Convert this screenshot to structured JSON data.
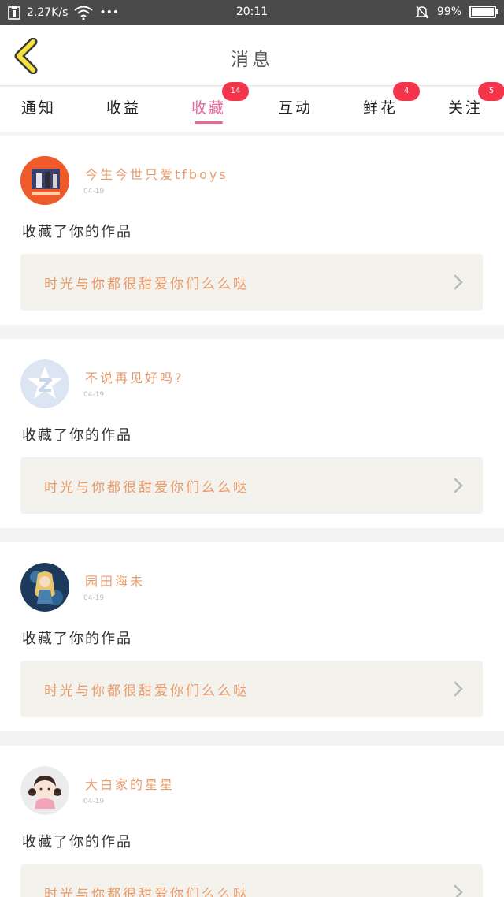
{
  "status_bar": {
    "speed": "2.27K/s",
    "dots": "•••",
    "time": "20:11",
    "battery": "99%",
    "battery_level": 0.99
  },
  "header": {
    "title": "消息"
  },
  "tabs": [
    {
      "label": "通知",
      "badge": ""
    },
    {
      "label": "收益",
      "badge": ""
    },
    {
      "label": "收藏",
      "badge": "14",
      "active": true
    },
    {
      "label": "互动",
      "badge": ""
    },
    {
      "label": "鲜花",
      "badge": "4"
    },
    {
      "label": "关注",
      "badge": "5"
    }
  ],
  "messages": [
    {
      "username": "今生今世只爱tfboys",
      "date": "04-19",
      "action": "收藏了你的作品",
      "work_title": "时光与你都很甜爱你们么么哒"
    },
    {
      "username": "不说再见好吗?",
      "date": "04-19",
      "action": "收藏了你的作品",
      "work_title": "时光与你都很甜爱你们么么哒"
    },
    {
      "username": "园田海未",
      "date": "04-19",
      "action": "收藏了你的作品",
      "work_title": "时光与你都很甜爱你们么么哒"
    },
    {
      "username": "大白家的星星",
      "date": "04-19",
      "action": "收藏了你的作品",
      "work_title": "时光与你都很甜爱你们么么哒"
    }
  ],
  "colors": {
    "accent_pink": "#e8689a",
    "name_orange": "#e79b6d",
    "badge_red": "#f4344a",
    "back_yellow": "#f5e23c"
  }
}
